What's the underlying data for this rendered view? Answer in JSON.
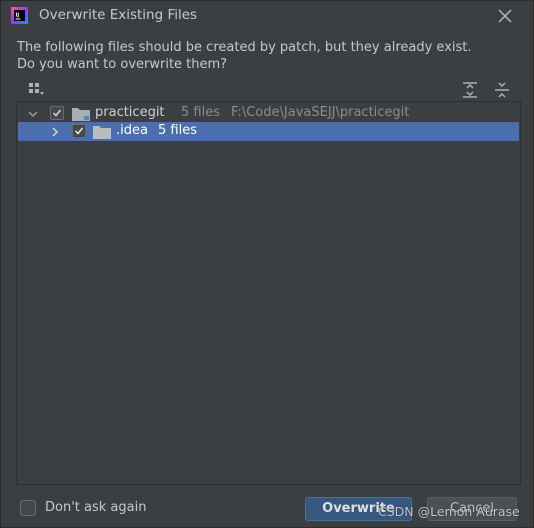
{
  "window": {
    "title": "Overwrite Existing Files",
    "app_icon": "intellij-idea-icon",
    "close_icon": "close-icon"
  },
  "message": {
    "line1": "The following files should be created by patch, but they already exist.",
    "line2": "Do you want to overwrite them?"
  },
  "toolbar": {
    "group_icon": "group-by-icon",
    "expand_all_icon": "expand-all-icon",
    "collapse_all_icon": "collapse-all-icon"
  },
  "tree": {
    "nodes": [
      {
        "name": "practicegit",
        "count": "5 files",
        "path": "F:\\Code\\JavaSEJJ\\practicegit",
        "expanded": true,
        "checked": true,
        "selected": false
      },
      {
        "name": ".idea",
        "count": "5 files",
        "expanded": false,
        "checked": true,
        "selected": true
      }
    ]
  },
  "footer": {
    "dont_ask_label": "Don't ask again",
    "dont_ask_checked": false,
    "overwrite_label": "Overwrite",
    "cancel_label": "Cancel"
  },
  "watermark": "CSDN @Lemon Aurase",
  "colors": {
    "background": "#3c3f41",
    "selection": "#4b6eaf",
    "primary_button": "#365880"
  }
}
